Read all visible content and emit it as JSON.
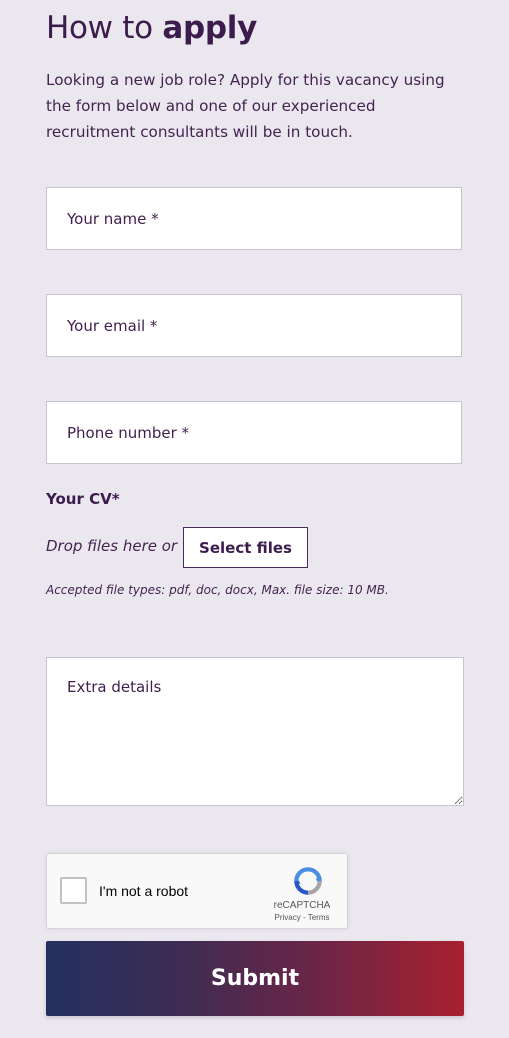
{
  "heading": {
    "prefix": "How to",
    "emphasis": "apply"
  },
  "intro_text": "Looking a new job role? Apply for this vacancy using the form below and one of our experienced recruitment consultants will be in touch.",
  "form": {
    "name_placeholder": "Your name *",
    "email_placeholder": "Your email *",
    "phone_placeholder": "Phone number *",
    "cv_label": "Your CV*",
    "drop_text": "Drop files here or",
    "select_files_label": "Select files",
    "accepted_text": "Accepted file types: pdf, doc, docx, Max. file size: 10 MB.",
    "extra_details_placeholder": "Extra details",
    "submit_label": "Submit"
  },
  "recaptcha": {
    "label": "I'm not a robot",
    "brand": "reCAPTCHA",
    "links": "Privacy - Terms",
    "icon": "recaptcha-logo"
  },
  "colors": {
    "background": "#ebe7ef",
    "text": "#3f1f4e",
    "submit_gradient_start": "#23305f",
    "submit_gradient_end": "#a8202e"
  }
}
